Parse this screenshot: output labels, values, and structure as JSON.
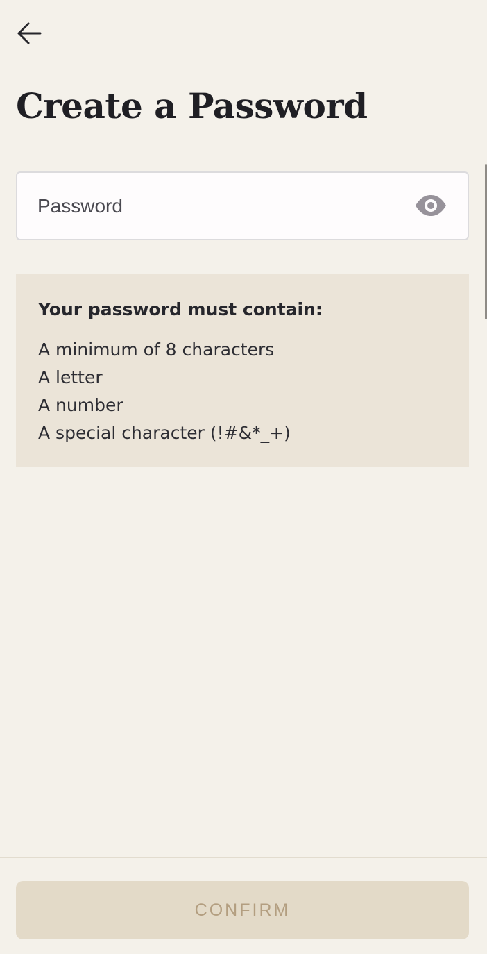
{
  "header": {
    "back_icon": "arrow-left-icon",
    "title": "Create a Password"
  },
  "password_field": {
    "placeholder": "Password",
    "value": "",
    "toggle_icon": "eye-icon",
    "icon_color": "#97929a"
  },
  "requirements": {
    "heading": "Your password must contain:",
    "items": [
      "A minimum of 8 characters",
      "A letter",
      "A number",
      "A special character (!#&*_+)"
    ]
  },
  "footer": {
    "confirm_label": "CONFIRM",
    "confirm_enabled": false
  },
  "colors": {
    "background": "#f4f1ea",
    "requirements_background": "#ebe4d8",
    "button_background": "#e3dac8",
    "button_text": "#b39e80"
  }
}
